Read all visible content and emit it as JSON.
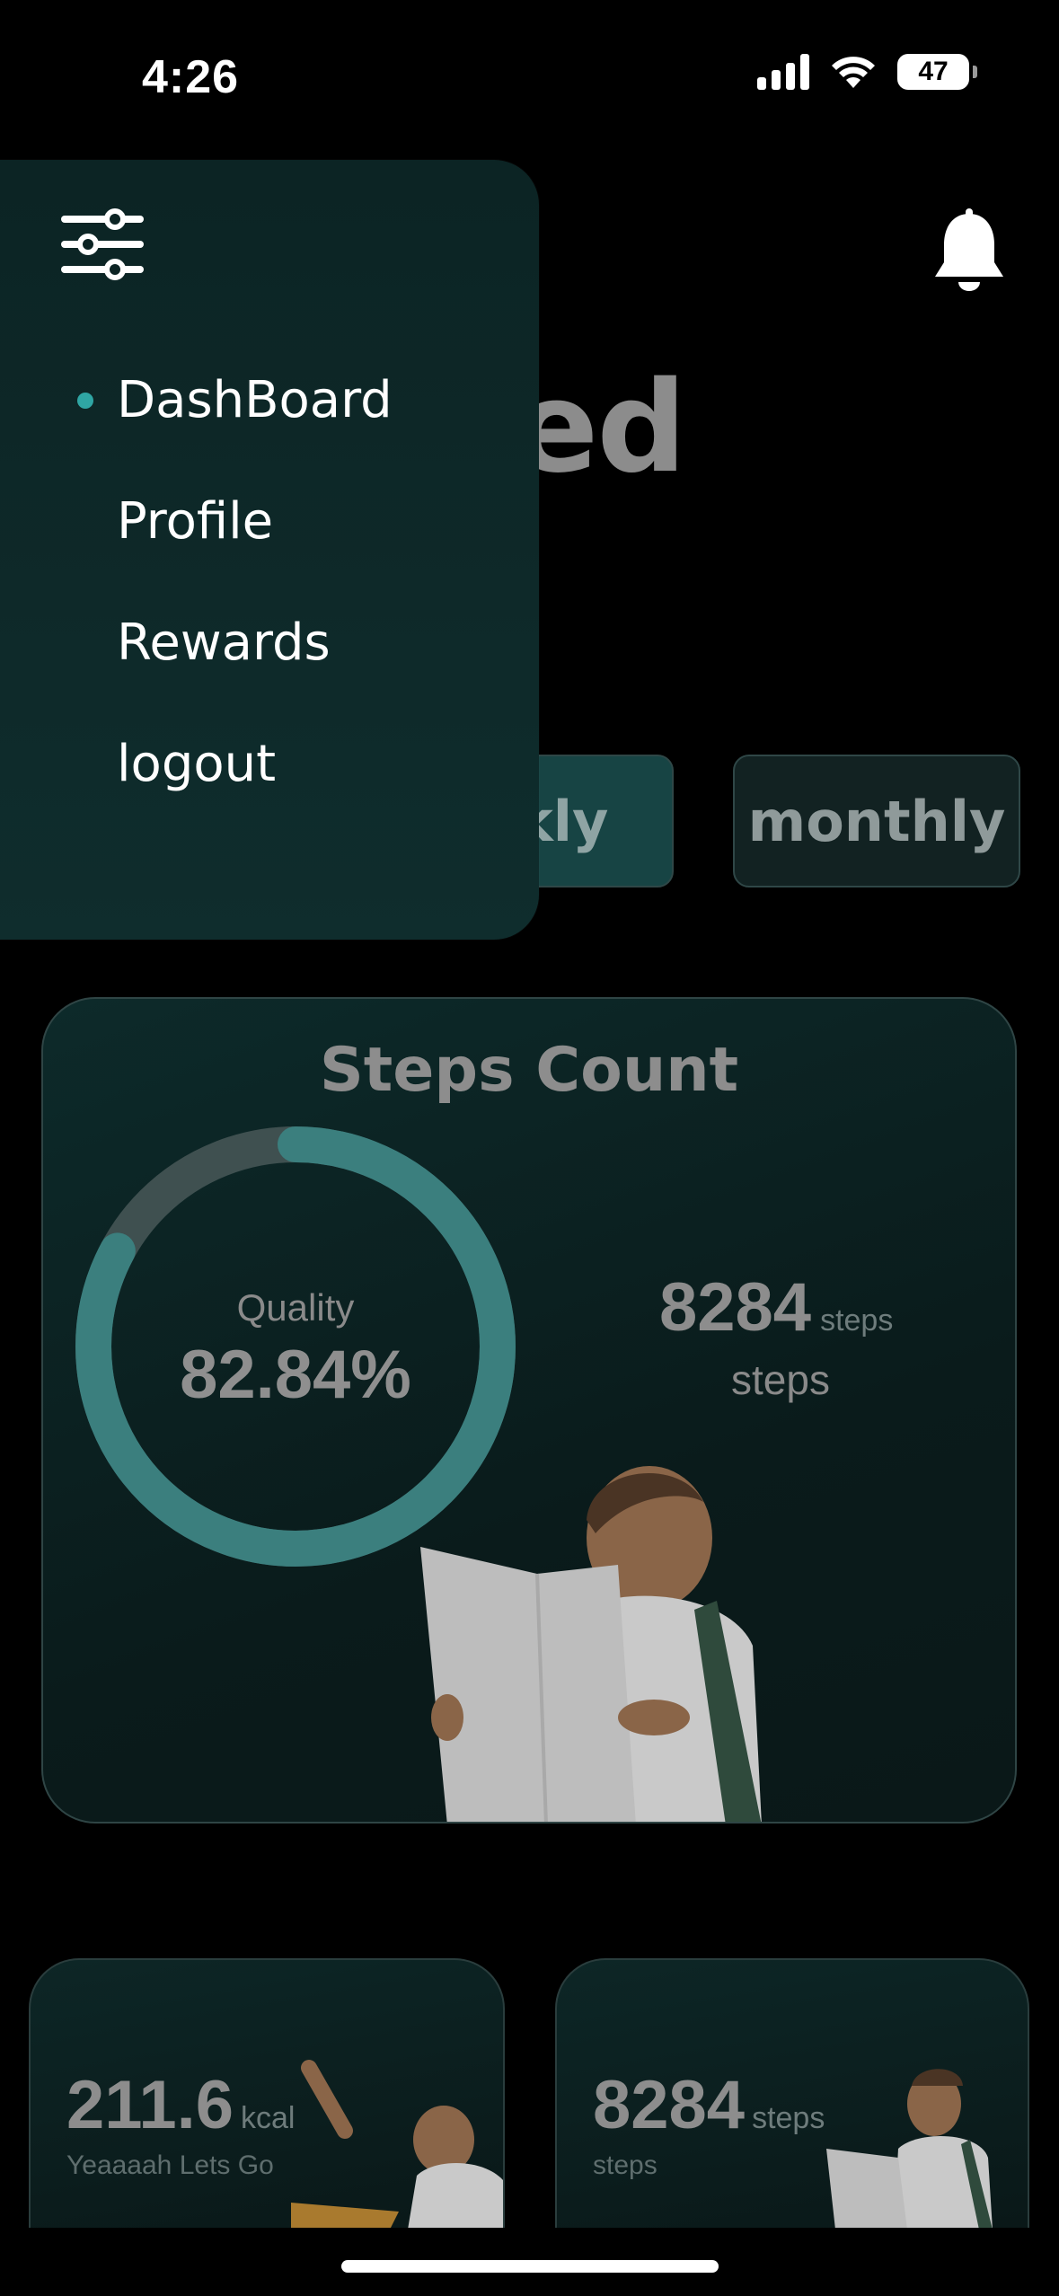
{
  "status_bar": {
    "time": "4:26",
    "battery": "47"
  },
  "header": {
    "greeting_fragment": "amed"
  },
  "period_tabs": {
    "weekly_fragment": "ekly",
    "monthly": "monthly"
  },
  "steps_card": {
    "title": "Steps Count",
    "ring_label": "Quality",
    "ring_value": "82.84%",
    "quality_fraction": 0.8284,
    "steps_value": "8284",
    "steps_unit": "steps",
    "steps_sub": "steps"
  },
  "mini_cards": [
    {
      "value": "211.6",
      "unit": "kcal",
      "sub": "Yeaaaah Lets Go"
    },
    {
      "value": "8284",
      "unit": "steps",
      "sub": "steps"
    }
  ],
  "menu": {
    "items": [
      {
        "label": "DashBoard",
        "active": true
      },
      {
        "label": "Profile",
        "active": false
      },
      {
        "label": "Rewards",
        "active": false
      },
      {
        "label": "logout",
        "active": false
      }
    ]
  },
  "colors": {
    "accent": "#2fa6a4",
    "menu_bg": "#0c2424",
    "ring_track": "#4a5a5a",
    "ring_fill": "#3a8482"
  },
  "icons": {
    "menu_toggle": "sliders-icon",
    "notifications": "bell-icon"
  }
}
